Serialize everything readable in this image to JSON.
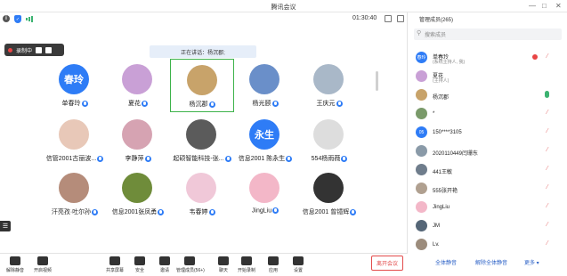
{
  "window": {
    "title": "腾讯会议",
    "controls": [
      "—",
      "□",
      "✕"
    ]
  },
  "topbar": {
    "timer": "01:30:40"
  },
  "recording": {
    "label": "录制中"
  },
  "speaking": {
    "text": "正在讲话：杨沉郡;"
  },
  "participants": [
    {
      "name": "单春玲",
      "avatar_text": "春玲",
      "color": "#2e7cf6"
    },
    {
      "name": "夏花",
      "avatar_text": "",
      "color": "#c9a0d6"
    },
    {
      "name": "杨沉郡",
      "avatar_text": "",
      "color": "#c8a36a",
      "active": true
    },
    {
      "name": "杨光颐",
      "avatar_text": "",
      "color": "#6a8fc9"
    },
    {
      "name": "王庆元",
      "avatar_text": "",
      "color": "#a9b8c8"
    },
    {
      "name": "信管2001古丽波...",
      "avatar_text": "",
      "color": "#e8c8b8"
    },
    {
      "name": "李静萍",
      "avatar_text": "",
      "color": "#d6a3b2"
    },
    {
      "name": "起硕智能科技-张...",
      "avatar_text": "",
      "color": "#5b5b5b"
    },
    {
      "name": "信息2001 陈永生",
      "avatar_text": "永生",
      "color": "#2e7cf6"
    },
    {
      "name": "554杨雨薇",
      "avatar_text": "",
      "color": "#dddddd"
    },
    {
      "name": "汗亮孜·吐尔孙",
      "avatar_text": "",
      "color": "#b58c7a"
    },
    {
      "name": "信息2001张凤勇",
      "avatar_text": "",
      "color": "#6f8c3a"
    },
    {
      "name": "韦春婷",
      "avatar_text": "",
      "color": "#f0c8d8"
    },
    {
      "name": "JingLiu",
      "avatar_text": "",
      "color": "#f3b7c8"
    },
    {
      "name": "信息2001 曾镱辉",
      "avatar_text": "",
      "color": "#333333"
    }
  ],
  "toolbar": {
    "items": [
      "解除静音",
      "开启视频",
      "共享屏幕",
      "安全",
      "邀请",
      "管理成员(56+)",
      "聊天",
      "开始录制",
      "应用",
      "设置"
    ],
    "leave": "离开会议"
  },
  "panel": {
    "title": "管理成员(265)",
    "search_placeholder": "搜索成员",
    "members": [
      {
        "name": "单春玲",
        "role": "(系统主持人, 我)",
        "avatar_text": "春玲",
        "color": "#2e7cf6",
        "recording": true,
        "muted": true
      },
      {
        "name": "夏花",
        "role": "(主持人)",
        "avatar_text": "",
        "color": "#c9a0d6",
        "muted": false,
        "mic_on": false
      },
      {
        "name": "杨沉郡",
        "role": "",
        "avatar_text": "",
        "color": "#c8a36a",
        "mic_on": true
      },
      {
        "name": "*",
        "role": "",
        "avatar_text": "",
        "color": "#7a9a6a",
        "muted": true
      },
      {
        "name": "150****3105",
        "role": "",
        "avatar_text": "05",
        "color": "#2e7cf6",
        "muted": true
      },
      {
        "name": "2020110449闫珊东",
        "role": "",
        "avatar_text": "",
        "color": "#8a9aa8",
        "muted": true
      },
      {
        "name": "441王敏",
        "role": "",
        "avatar_text": "",
        "color": "#6f7d8c",
        "muted": true
      },
      {
        "name": "555张开艳",
        "role": "",
        "avatar_text": "",
        "color": "#b0a090",
        "muted": true
      },
      {
        "name": "JingLiu",
        "role": "",
        "avatar_text": "",
        "color": "#f3b7c8",
        "muted": true
      },
      {
        "name": "JM",
        "role": "",
        "avatar_text": "",
        "color": "#556677",
        "muted": true
      },
      {
        "name": "Lv.",
        "role": "",
        "avatar_text": "",
        "color": "#9c8c7c",
        "muted": true
      }
    ],
    "footer": {
      "mute_all": "全体静音",
      "unmute_all": "解除全体静音",
      "more": "更多 ▾"
    }
  }
}
